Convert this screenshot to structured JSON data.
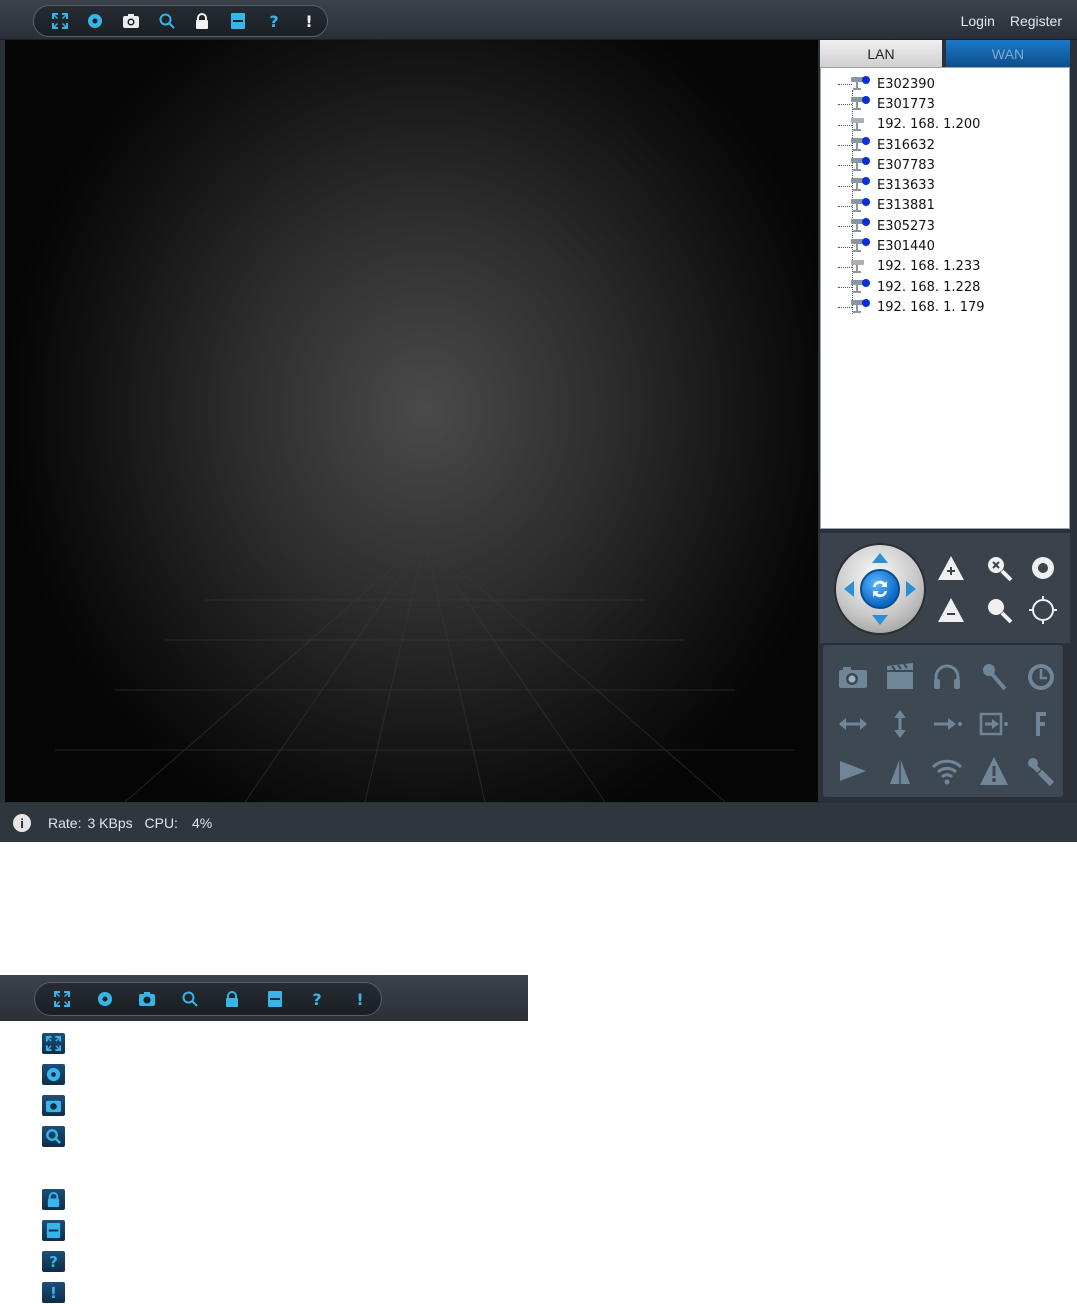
{
  "header": {
    "toolbar_icons": [
      "fullscreen-icon",
      "settings-icon",
      "snapshot-icon",
      "search-icon",
      "lock-icon",
      "save-icon",
      "help-icon",
      "about-icon"
    ],
    "login_label": "Login",
    "register_label": "Register"
  },
  "tabs": {
    "lan_label": "LAN",
    "wan_label": "WAN",
    "active": "LAN"
  },
  "devices": [
    {
      "label": "E302390",
      "status": "online"
    },
    {
      "label": "E301773",
      "status": "online"
    },
    {
      "label": "192. 168. 1.200",
      "status": "offline"
    },
    {
      "label": "E316632",
      "status": "online"
    },
    {
      "label": "E307783",
      "status": "online"
    },
    {
      "label": "E313633",
      "status": "online"
    },
    {
      "label": "E313881",
      "status": "online"
    },
    {
      "label": "E305273",
      "status": "online"
    },
    {
      "label": "E301440",
      "status": "online"
    },
    {
      "label": "192. 168. 1.233",
      "status": "offline"
    },
    {
      "label": "192. 168. 1.228",
      "status": "online"
    },
    {
      "label": "192. 168. 1. 179",
      "status": "online"
    }
  ],
  "ptz": {
    "buttons": [
      "focus-in-icon",
      "zoom-in-icon",
      "iris-open-icon",
      "focus-out-icon",
      "zoom-out-icon",
      "iris-close-icon"
    ]
  },
  "functions": {
    "icons": [
      "camera-icon",
      "record-icon",
      "headphones-icon",
      "microphone-icon",
      "timer-icon",
      "horizontal-scan-icon",
      "vertical-scan-icon",
      "preset-go-icon",
      "preset-set-icon",
      "flip-icon",
      "mirror-icon",
      "mirror-vertical-icon",
      "wifi-icon",
      "alarm-icon",
      "tools-icon"
    ]
  },
  "status": {
    "rate_label": "Rate:",
    "rate_value": "3 KBps",
    "cpu_label": "CPU:",
    "cpu_value": "4%"
  },
  "legend": {
    "icons": [
      "fullscreen-icon",
      "settings-icon",
      "snapshot-icon",
      "search-icon",
      "lock-icon",
      "save-icon",
      "help-icon",
      "about-icon"
    ]
  },
  "colors": {
    "accent_blue": "#2aa6e0",
    "toolbar_bg": "#2a3036",
    "wan_tab": "#0d4f8c"
  }
}
